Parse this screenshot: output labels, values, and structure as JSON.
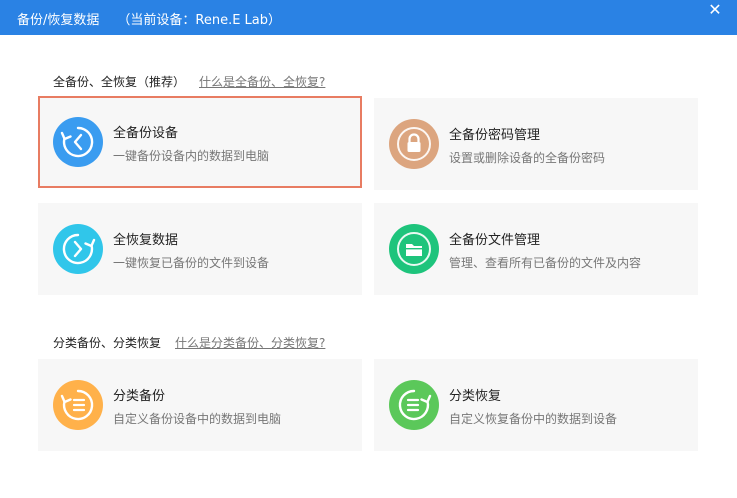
{
  "window": {
    "title": "备份/恢复数据",
    "device_label": "（当前设备：Rene.E Lab）",
    "close_glyph": "✕"
  },
  "full_section": {
    "label": "全备份、全恢复（推荐）",
    "help_link": "什么是全备份、全恢复?",
    "cards": [
      {
        "name": "全备份设备",
        "desc": "一键备份设备内的数据到电脑",
        "icon": "backup-restore-icon",
        "color": "#3a9cf0"
      },
      {
        "name": "全备份密码管理",
        "desc": "设置或删除设备的全备份密码",
        "icon": "lock-icon",
        "color": "#dca57f"
      },
      {
        "name": "全恢复数据",
        "desc": "一键恢复已备份的文件到设备",
        "icon": "restore-icon",
        "color": "#30c6ea"
      },
      {
        "name": "全备份文件管理",
        "desc": "管理、查看所有已备份的文件及内容",
        "icon": "folder-icon",
        "color": "#1ec47c"
      }
    ]
  },
  "category_section": {
    "label": "分类备份、分类恢复",
    "help_link": "什么是分类备份、分类恢复?",
    "cards": [
      {
        "name": "分类备份",
        "desc": "自定义备份设备中的数据到电脑",
        "icon": "category-backup-icon",
        "color": "#ffb14a"
      },
      {
        "name": "分类恢复",
        "desc": "自定义恢复备份中的数据到设备",
        "icon": "category-restore-icon",
        "color": "#5bc85a"
      }
    ]
  },
  "colors": {
    "titlebar": "#2a82e4",
    "selected_border": "#e87c62",
    "card_bg": "#f7f7f7"
  }
}
